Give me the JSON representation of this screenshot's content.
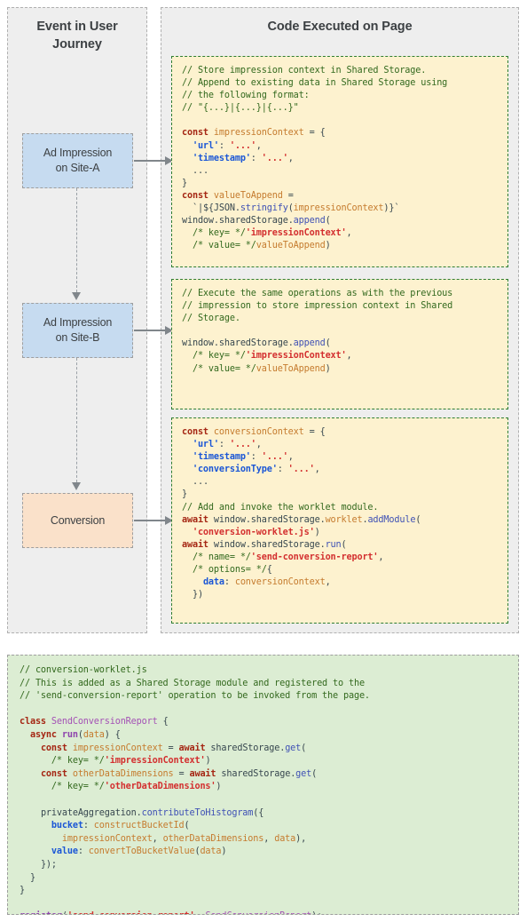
{
  "columns": {
    "left": {
      "title": "Event in User\nJourney"
    },
    "right": {
      "title": "Code Executed on Page"
    }
  },
  "events": [
    {
      "label": "Ad Impression\non Site-A",
      "color": "#c6dbf0"
    },
    {
      "label": "Ad Impression\non Site-B",
      "color": "#c6dbf0"
    },
    {
      "label": "Conversion",
      "color": "#fae1ca"
    }
  ],
  "code_blocks": [
    {
      "name": "impression-site-a-code",
      "background": "#fdf2cf",
      "border_color": "#2e7d32",
      "lines": [
        "// Store impression context in Shared Storage.",
        "// Append to existing data in Shared Storage using",
        "// the following format:",
        "// \"{...}|{...}|{...}\"",
        "",
        "const impressionContext = {",
        "  'url': '...',",
        "  'timestamp': '...',",
        "  ...",
        "}",
        "const valueToAppend =",
        "  `|${JSON.stringify(impressionContext)}`",
        "window.sharedStorage.append(",
        "  /* key= */'impressionContext',",
        "  /* value= */valueToAppend)"
      ]
    },
    {
      "name": "impression-site-b-code",
      "background": "#fdf2cf",
      "border_color": "#2e7d32",
      "lines": [
        "// Execute the same operations as with the previous",
        "// impression to store impression context in Shared",
        "// Storage.",
        "",
        "window.sharedStorage.append(",
        "  /* key= */'impressionContext',",
        "  /* value= */valueToAppend)"
      ]
    },
    {
      "name": "conversion-code",
      "background": "#fdf2cf",
      "border_color": "#2e7d32",
      "lines": [
        "const conversionContext = {",
        "  'url': '...',",
        "  'timestamp': '...',",
        "  'conversionType': '...',",
        "  ...",
        "}",
        "// Add and invoke the worklet module.",
        "await window.sharedStorage.worklet.addModule(",
        "  'conversion-worklet.js')",
        "await window.sharedStorage.run(",
        "  /* name= */'send-conversion-report',",
        "  /* options= */{",
        "    data: conversionContext,",
        "  })"
      ]
    }
  ],
  "worklet_block": {
    "name": "conversion-worklet-code",
    "background": "#dcedd3",
    "border_color": "#9e9e9e",
    "lines": [
      "// conversion-worklet.js",
      "// This is added as a Shared Storage module and registered to the",
      "// 'send-conversion-report' operation to be invoked from the page.",
      "",
      "class SendConversionReport {",
      "  async run(data) {",
      "    const impressionContext = await sharedStorage.get(",
      "      /* key= */'impressionContext')",
      "    const otherDataDimensions = await sharedStorage.get(",
      "      /* key= */'otherDataDimensions')",
      "",
      "    privateAggregation.contributeToHistogram({",
      "      bucket: constructBucketId(",
      "        impressionContext, otherDataDimensions, data),",
      "      value: convertToBucketValue(data)",
      "    });",
      "  }",
      "}",
      "",
      "register('send-conversion-report', SendConversionReport);"
    ]
  },
  "arrows": [
    {
      "name": "arrow-impression-a-to-code",
      "direction": "right"
    },
    {
      "name": "arrow-impression-b-to-code",
      "direction": "right"
    },
    {
      "name": "arrow-conversion-to-code",
      "direction": "right"
    },
    {
      "name": "arrow-site-a-to-site-b",
      "direction": "down"
    },
    {
      "name": "arrow-site-b-to-conversion",
      "direction": "down"
    }
  ],
  "colors": {
    "column_background": "#eeeeee",
    "impression_box": "#c6dbf0",
    "conversion_box": "#fae1ca",
    "code_yellow": "#fdf2cf",
    "code_green": "#dcedd3",
    "comment": "#33691e",
    "keyword": "#a52714",
    "identifier": "#c57b2e",
    "string_blue": "#1a56d6",
    "string_red": "#d32f2f",
    "method": "#3f51b5",
    "class_name": "#a451b5",
    "arrow": "#80868b"
  }
}
